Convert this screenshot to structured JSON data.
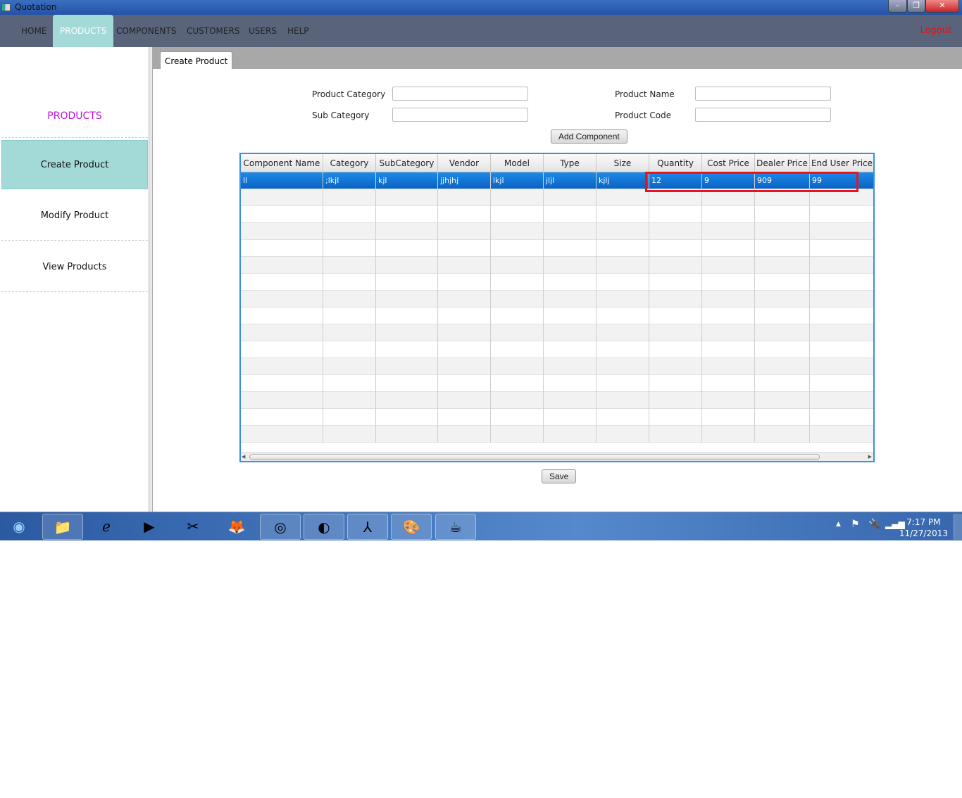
{
  "window": {
    "title": "Quotation"
  },
  "nav": {
    "items": [
      "HOME",
      "PRODUCTS",
      "COMPONENTS",
      "CUSTOMERS",
      "USERS",
      "HELP"
    ],
    "active": "PRODUCTS",
    "logout": "Logout"
  },
  "sidebar": {
    "heading": "PRODUCTS",
    "items": [
      "Create Product",
      "Modify Product",
      "View Products"
    ],
    "active": "Create Product"
  },
  "tab": {
    "label": "Create Product"
  },
  "form": {
    "product_category_label": "Product Category",
    "sub_category_label": "Sub Category",
    "product_name_label": "Product Name",
    "product_code_label": "Product Code",
    "product_category": "",
    "sub_category": "",
    "product_name": "",
    "product_code": "",
    "add_component": "Add Component",
    "save": "Save"
  },
  "table": {
    "columns": [
      "Component Name",
      "Category",
      "SubCategory",
      "Vendor",
      "Model",
      "Type",
      "Size",
      "Quantity",
      "Cost Price",
      "Dealer Price",
      "End User Price"
    ],
    "rows": [
      [
        "ll",
        ";lkjl",
        "kjl",
        "jjhjhj",
        "lkjl",
        "jljl",
        "kjlj",
        "12",
        "9",
        "909",
        "99"
      ]
    ],
    "selected_row": 0
  },
  "taskbar": {
    "apps": [
      "start-orb",
      "file-explorer",
      "internet-explorer",
      "media-player",
      "tools",
      "firefox",
      "chrome",
      "eclipse",
      "acrobat",
      "paint",
      "java"
    ],
    "time": "7:17 PM",
    "date": "11/27/2013"
  },
  "colors": {
    "accent": "#a3d9d7",
    "nav_bg": "#59647a",
    "selection": "#0a62c4",
    "highlight_box": "#e8141c",
    "heading": "#c010e0",
    "logout": "#e81010"
  }
}
